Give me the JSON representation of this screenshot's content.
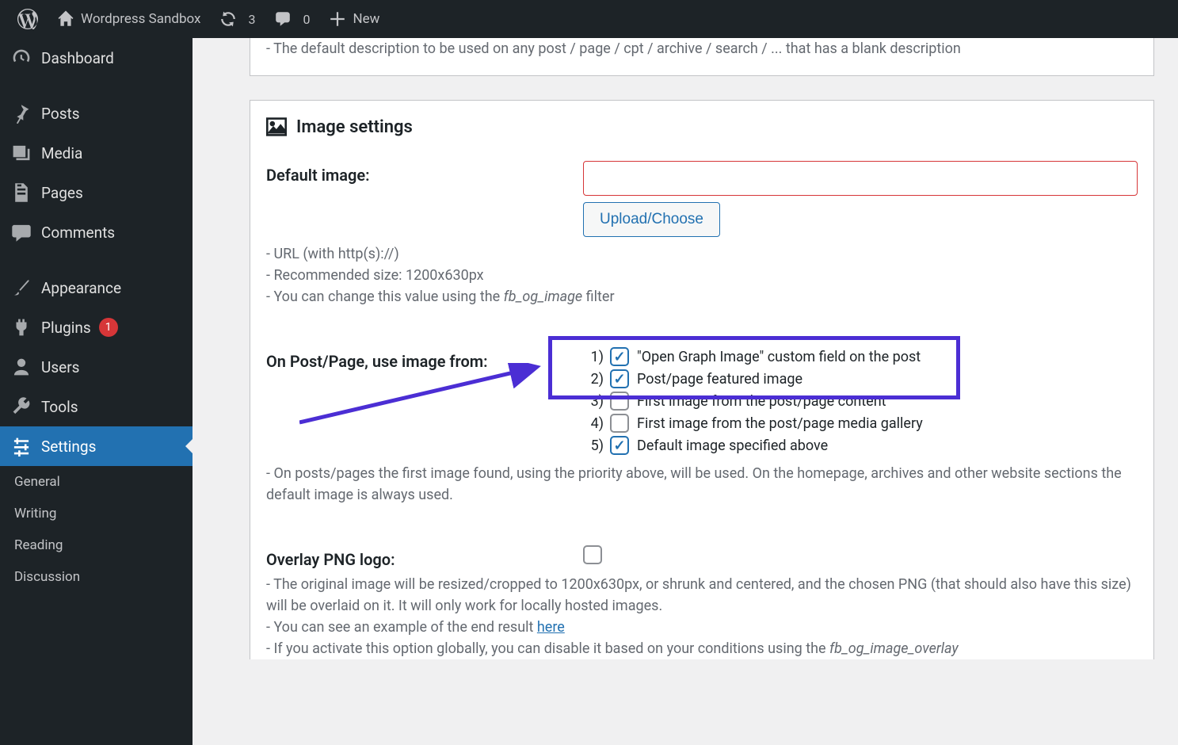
{
  "adminBar": {
    "siteName": "Wordpress Sandbox",
    "refreshCount": "3",
    "commentCount": "0",
    "newLabel": "New"
  },
  "sidebar": {
    "dashboard": "Dashboard",
    "posts": "Posts",
    "media": "Media",
    "pages": "Pages",
    "comments": "Comments",
    "appearance": "Appearance",
    "plugins": "Plugins",
    "pluginsBadge": "1",
    "users": "Users",
    "tools": "Tools",
    "settings": "Settings",
    "sub": {
      "general": "General",
      "writing": "Writing",
      "reading": "Reading",
      "discussion": "Discussion"
    }
  },
  "topDesc": "- The default description to be used on any post / page / cpt / archive / search / ... that has a blank description",
  "section": {
    "title": "Image settings",
    "defaultImageLabel": "Default image:",
    "uploadBtn": "Upload/Choose",
    "note1": "- URL (with http(s)://)",
    "note2": "- Recommended size: 1200x630px",
    "note3a": "- You can change this value using the ",
    "note3filter": "fb_og_image",
    "note3b": " filter",
    "priorityLabel": "On Post/Page, use image from:",
    "priority": [
      {
        "num": "1)",
        "label": "\"Open Graph Image\" custom field on the post",
        "checked": true
      },
      {
        "num": "2)",
        "label": "Post/page featured image",
        "checked": true
      },
      {
        "num": "3)",
        "label": "First image from the post/page content",
        "checked": false
      },
      {
        "num": "4)",
        "label": "First image from the post/page media gallery",
        "checked": false
      },
      {
        "num": "5)",
        "label": "Default image specified above",
        "checked": true
      }
    ],
    "priorityNote": "- On posts/pages the first image found, using the priority above, will be used. On the homepage, archives and other website sections the default image is always used.",
    "overlayLabel": "Overlay PNG logo:",
    "overlayNote1": "- The original image will be resized/cropped to 1200x630px, or shrunk and centered, and the chosen PNG (that should also have this size) will be overlaid on it. It will only work for locally hosted images.",
    "overlayNote2a": "- You can see an example of the end result ",
    "overlayNote2link": "here",
    "overlayNote3a": "- If you activate this option globally, you can disable it based on your conditions using the ",
    "overlayNote3filter": "fb_og_image_overlay"
  }
}
